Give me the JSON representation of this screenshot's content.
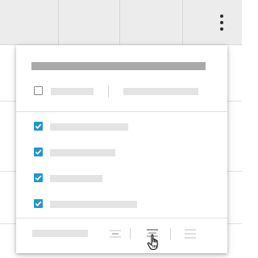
{
  "table_header": {
    "menu_icon": "more-vertical-icon"
  },
  "column_menu": {
    "select_all": {
      "checked": false
    },
    "options": [
      {
        "checked": true
      },
      {
        "checked": true
      },
      {
        "checked": true
      },
      {
        "checked": true
      }
    ],
    "footer": {
      "align_icons": [
        "align-left-icon",
        "align-center-icon",
        "align-right-icon"
      ]
    }
  },
  "colors": {
    "checkbox_checked": "#2196d3",
    "header_bg": "#ececec",
    "placeholder_text": "#e3e3e3",
    "title_placeholder": "#a9a9a9"
  }
}
